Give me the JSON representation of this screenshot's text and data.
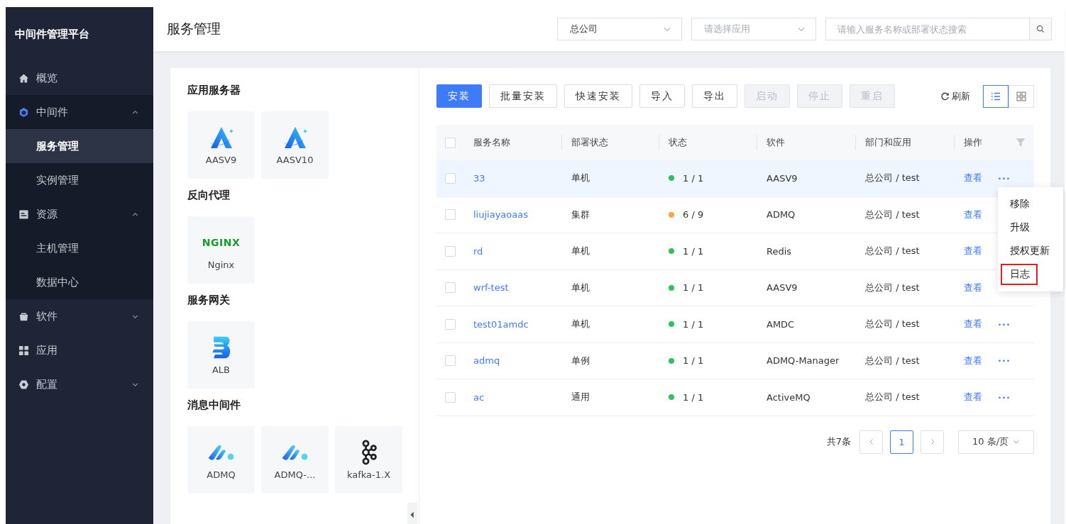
{
  "sidebar": {
    "title": "中间件管理平台",
    "items": [
      {
        "label": "概览",
        "kind": "home",
        "selected": false
      },
      {
        "label": "中间件",
        "kind": "cube",
        "expanded": true,
        "selected": false,
        "children": [
          {
            "label": "服务管理",
            "selected": true
          },
          {
            "label": "实例管理",
            "selected": false
          }
        ]
      },
      {
        "label": "资源",
        "kind": "list",
        "expanded": true,
        "selected": false,
        "children": [
          {
            "label": "主机管理",
            "selected": false
          },
          {
            "label": "数据中心",
            "selected": false
          }
        ]
      },
      {
        "label": "软件",
        "kind": "bag",
        "expanded": false,
        "selected": false
      },
      {
        "label": "应用",
        "kind": "grid",
        "selected": false
      },
      {
        "label": "配置",
        "kind": "gear",
        "expanded": false,
        "selected": false
      }
    ]
  },
  "header": {
    "title": "服务管理",
    "company_select": {
      "value": "总公司"
    },
    "app_select": {
      "placeholder": "请选择应用"
    },
    "search": {
      "placeholder": "请输入服务名称或部署状态搜索"
    }
  },
  "catalog": [
    {
      "title": "应用服务器",
      "items": [
        {
          "name": "AASV9",
          "kind": "aas"
        },
        {
          "name": "AASV10",
          "kind": "aas"
        }
      ]
    },
    {
      "title": "反向代理",
      "items": [
        {
          "name": "Nginx",
          "kind": "nginx",
          "logo_text": "NGINX"
        }
      ]
    },
    {
      "title": "服务网关",
      "items": [
        {
          "name": "ALB",
          "kind": "alb"
        }
      ]
    },
    {
      "title": "消息中间件",
      "items": [
        {
          "name": "ADMQ",
          "kind": "admq"
        },
        {
          "name": "ADMQ-...",
          "kind": "admq"
        },
        {
          "name": "kafka-1.X",
          "kind": "kafka"
        }
      ]
    }
  ],
  "toolbar": {
    "buttons": [
      {
        "label": "安装",
        "kind": "primary",
        "disabled": false
      },
      {
        "label": "批量安装",
        "kind": "default",
        "disabled": false
      },
      {
        "label": "快速安装",
        "kind": "default",
        "disabled": false
      },
      {
        "label": "导入",
        "kind": "default",
        "disabled": false
      },
      {
        "label": "导出",
        "kind": "default",
        "disabled": false
      },
      {
        "label": "启动",
        "kind": "default",
        "disabled": true
      },
      {
        "label": "停止",
        "kind": "default",
        "disabled": true
      },
      {
        "label": "重启",
        "kind": "default",
        "disabled": true
      }
    ],
    "refresh": "刷新",
    "views": [
      {
        "kind": "list",
        "selected": true
      },
      {
        "kind": "grid",
        "selected": false
      }
    ]
  },
  "table": {
    "all_checked": false,
    "columns": [
      "服务名称",
      "部署状态",
      "状态",
      "软件",
      "部门和应用",
      "操作"
    ],
    "rows": [
      {
        "name": "33",
        "deploy": "单机",
        "status": "1 / 1",
        "color": "#2fc25b",
        "software": "AASV9",
        "dept": "总公司 / test",
        "action": "查看",
        "more": "···",
        "checked": false,
        "hovered": true
      },
      {
        "name": "liujiayaoaas",
        "deploy": "集群",
        "status": "6 / 9",
        "color": "#f5a742",
        "software": "ADMQ",
        "dept": "总公司 / test",
        "action": "查看",
        "checked": false,
        "hovered": false
      },
      {
        "name": "rd",
        "deploy": "单机",
        "status": "1 / 1",
        "color": "#2fc25b",
        "software": "Redis",
        "dept": "总公司 / test",
        "action": "查看",
        "checked": false,
        "hovered": false
      },
      {
        "name": "wrf-test",
        "deploy": "单机",
        "status": "1 / 1",
        "color": "#2fc25b",
        "software": "AASV9",
        "dept": "总公司 / test",
        "action": "查看",
        "checked": false,
        "hovered": false
      },
      {
        "name": "test01amdc",
        "deploy": "单机",
        "status": "1 / 1",
        "color": "#2fc25b",
        "software": "AMDC",
        "dept": "总公司 / test",
        "action": "查看",
        "more": "···",
        "checked": false,
        "hovered": false
      },
      {
        "name": "admq",
        "deploy": "单例",
        "status": "1 / 1",
        "color": "#2fc25b",
        "software": "ADMQ-Manager",
        "dept": "总公司 / test",
        "action": "查看",
        "more": "···",
        "checked": false,
        "hovered": false
      },
      {
        "name": "ac",
        "deploy": "通用",
        "status": "1 / 1",
        "color": "#2fc25b",
        "software": "ActiveMQ",
        "dept": "总公司 / test",
        "action": "查看",
        "more": "···",
        "checked": false,
        "hovered": false
      }
    ],
    "row_menu_open": true,
    "row_menu": [
      {
        "label": "移除",
        "highlighted": false
      },
      {
        "label": "升级",
        "highlighted": false
      },
      {
        "label": "授权更新",
        "highlighted": false
      },
      {
        "label": "日志",
        "highlighted": true
      }
    ]
  },
  "pagination": {
    "total": "共7条",
    "pages": [
      {
        "label": "1",
        "selected": true
      }
    ],
    "page_size": "10 条/页"
  }
}
